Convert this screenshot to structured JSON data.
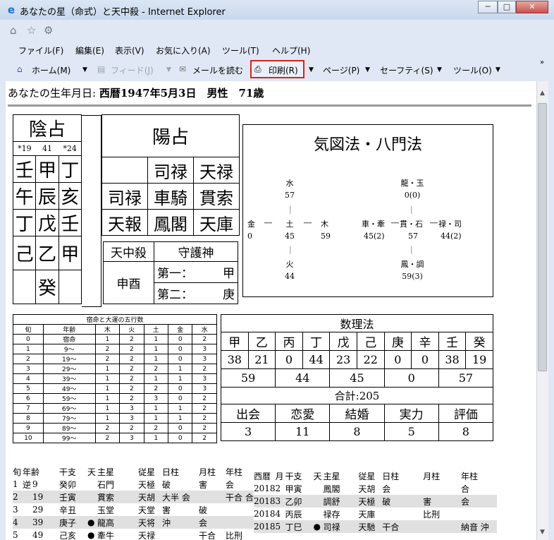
{
  "window": {
    "title": "あなたの星（命式）と天中殺 - Internet Explorer",
    "controls": [
      "─",
      "□",
      "✕"
    ]
  },
  "menubar": [
    "ファイル(F)",
    "編集(E)",
    "表示(V)",
    "お気に入り(A)",
    "ツール(T)",
    "ヘルプ(H)"
  ],
  "commandbar": {
    "home": "ホーム(M)",
    "feeds": "フィード(J)",
    "mail": "メールを読む",
    "print": "印刷(R)",
    "page": "ページ(P)",
    "safety": "セーフティ(S)",
    "tools": "ツール(O)"
  },
  "header": {
    "label": "あなたの生年月日: ",
    "birth": "西暦1947年5月3日",
    "gender": "男性",
    "age": "71歳"
  },
  "inyo": {
    "title": "陰占",
    "sub": [
      "*19",
      "41",
      "*24"
    ],
    "row1": [
      "壬",
      "甲",
      "丁"
    ],
    "row2": [
      "午",
      "辰",
      "亥"
    ],
    "row3": [
      "丁",
      "戊",
      "壬"
    ],
    "row4": [
      "己",
      "乙",
      "甲"
    ],
    "row5": "癸"
  },
  "yosen": {
    "title": "陽占",
    "r1": [
      "",
      "司禄",
      "天禄"
    ],
    "r2": [
      "司禄",
      "車騎",
      "貫索"
    ],
    "r3": [
      "天報",
      "鳳閣",
      "天庫"
    ],
    "tenchusatsu_label": "天中殺",
    "tenchusatsu": "申酉",
    "shugo_label": "守護神",
    "first_label": "第一：",
    "first": "甲",
    "second_label": "第二：",
    "second": "庚"
  },
  "kizu": {
    "title": "気図法・八門法",
    "left": {
      "top": [
        "水",
        "57"
      ],
      "mid": [
        [
          "金",
          "0"
        ],
        [
          "土",
          "45"
        ],
        [
          "木",
          "59"
        ]
      ],
      "bottom": [
        "火",
        "44"
      ]
    },
    "right": {
      "top": [
        "龍・玉",
        "0(0)"
      ],
      "mid": [
        [
          "車・牽",
          "45(2)"
        ],
        [
          "貫・石",
          "57"
        ],
        [
          "禄・司",
          "44(2)"
        ]
      ],
      "bottom": [
        "鳳・調",
        "59(3)"
      ]
    }
  },
  "gogyo": {
    "caption": "宿命と大運の五行数",
    "headers": [
      "旬",
      "年齢",
      "木",
      "火",
      "土",
      "金",
      "水"
    ],
    "rows": [
      [
        "0",
        "宿命",
        "1",
        "2",
        "1",
        "0",
        "2"
      ],
      [
        "1",
        "9〜",
        "2",
        "2",
        "1",
        "0",
        "3"
      ],
      [
        "2",
        "19〜",
        "2",
        "2",
        "1",
        "0",
        "3"
      ],
      [
        "3",
        "29〜",
        "1",
        "2",
        "2",
        "1",
        "2"
      ],
      [
        "4",
        "39〜",
        "1",
        "2",
        "1",
        "1",
        "3"
      ],
      [
        "5",
        "49〜",
        "1",
        "2",
        "2",
        "0",
        "3"
      ],
      [
        "6",
        "59〜",
        "1",
        "2",
        "3",
        "0",
        "2"
      ],
      [
        "7",
        "69〜",
        "1",
        "3",
        "1",
        "1",
        "2"
      ],
      [
        "8",
        "79〜",
        "1",
        "3",
        "1",
        "1",
        "2"
      ],
      [
        "9",
        "89〜",
        "2",
        "2",
        "2",
        "0",
        "2"
      ],
      [
        "10",
        "99〜",
        "2",
        "3",
        "1",
        "0",
        "2"
      ]
    ]
  },
  "suri": {
    "title": "数理法",
    "stems": [
      "甲",
      "乙",
      "丙",
      "丁",
      "戊",
      "己",
      "庚",
      "辛",
      "壬",
      "癸"
    ],
    "values": [
      "38",
      "21",
      "0",
      "44",
      "23",
      "22",
      "0",
      "0",
      "38",
      "19"
    ],
    "pairs": [
      "59",
      "44",
      "45",
      "0",
      "57"
    ],
    "total": "合計:205",
    "cats": [
      "出会",
      "恋愛",
      "結婚",
      "実力",
      "評価"
    ],
    "catvals": [
      "3",
      "11",
      "8",
      "5",
      "8"
    ]
  },
  "taiun": {
    "headers": [
      "旬",
      "年齢",
      "干支",
      "天",
      "主星",
      "従星",
      "日柱",
      "月柱",
      "年柱"
    ],
    "rows": [
      [
        "1",
        "逆",
        "9",
        "癸卯",
        "",
        "石門",
        "天極",
        "破",
        "害",
        "会"
      ],
      [
        "2",
        "",
        "19",
        "壬寅",
        "",
        "貫索",
        "天胡",
        "大半 会",
        "",
        "干合 合"
      ],
      [
        "3",
        "",
        "29",
        "辛丑",
        "",
        "玉堂",
        "天堂",
        "害",
        "破",
        ""
      ],
      [
        "4",
        "",
        "39",
        "庚子",
        "●",
        "龍高",
        "天将",
        "沖",
        "会",
        ""
      ],
      [
        "5",
        "",
        "49",
        "己亥",
        "●",
        "牽牛",
        "天禄",
        "",
        "干合",
        "比刑"
      ]
    ]
  },
  "nenun": {
    "headers": [
      "西暦",
      "月",
      "干支",
      "天",
      "主星",
      "従星",
      "日柱",
      "月柱",
      "年柱"
    ],
    "rows": [
      [
        "2018",
        "2",
        "甲寅",
        "",
        "鳳閣",
        "天胡",
        "会",
        "",
        "合"
      ],
      [
        "2018",
        "3",
        "乙卯",
        "",
        "調舒",
        "天極",
        "破",
        "害",
        "会"
      ],
      [
        "2018",
        "4",
        "丙辰",
        "",
        "禄存",
        "天庫",
        "",
        "比刑",
        ""
      ],
      [
        "2018",
        "5",
        "丁巳",
        "●",
        "司禄",
        "天馳",
        "干合",
        "",
        "納音 沖"
      ]
    ]
  }
}
